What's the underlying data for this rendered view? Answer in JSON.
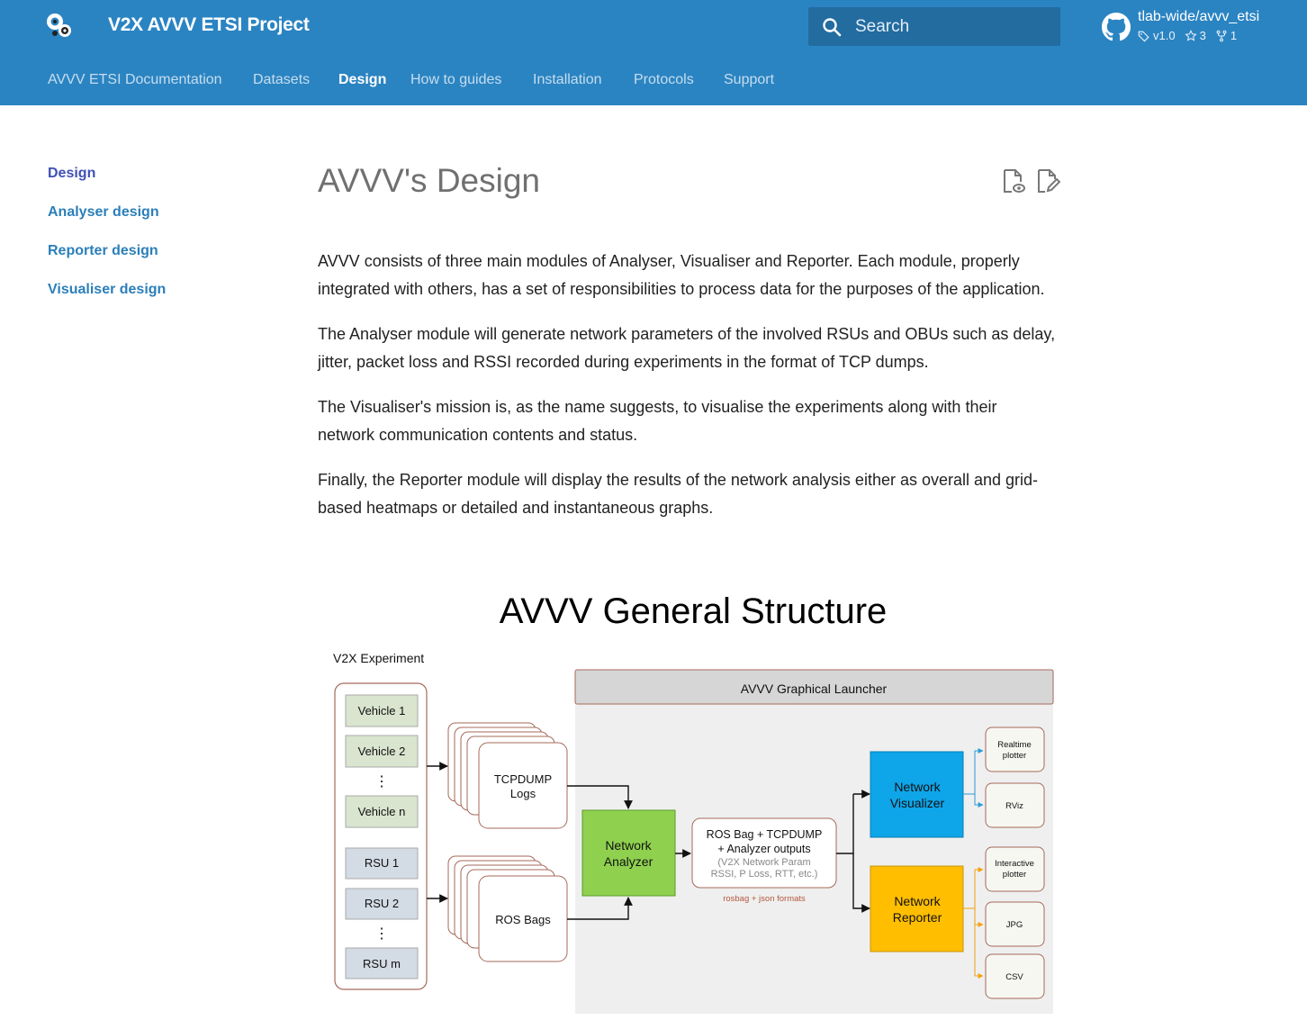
{
  "site": {
    "title": "V2X AVVV ETSI Project"
  },
  "search": {
    "placeholder": "Search"
  },
  "repo": {
    "name": "tlab-wide/avvv_etsi",
    "version": "v1.0",
    "stars": "3",
    "forks": "1"
  },
  "tabs": [
    {
      "label": "AVVV ETSI Documentation"
    },
    {
      "label": "Datasets"
    },
    {
      "label": "Design",
      "active": true
    },
    {
      "label": "How to guides"
    },
    {
      "label": "Installation"
    },
    {
      "label": "Protocols"
    },
    {
      "label": "Support"
    }
  ],
  "sidebar": {
    "items": [
      {
        "label": "Design",
        "active": true
      },
      {
        "label": "Analyser design"
      },
      {
        "label": "Reporter design"
      },
      {
        "label": "Visualiser design"
      }
    ]
  },
  "page": {
    "title": "AVVV's Design",
    "paragraphs": [
      "AVVV consists of three main modules of Analyser, Visualiser and Reporter. Each module, properly integrated with others, has a set of responsibilities to process data for the purposes of the application.",
      "The Analyser module will generate network parameters of the involved RSUs and OBUs such as delay, jitter, packet loss and RSSI recorded during experiments in the format of TCP dumps.",
      "The Visualiser's mission is, as the name suggests, to visualise the experiments along with their network communication contents and status.",
      "Finally, the Reporter module will display the results of the network analysis either as overall and grid-based heatmaps or detailed and instantaneous graphs."
    ]
  },
  "diagram": {
    "title": "AVVV General Structure",
    "experiment_label": "V2X Experiment",
    "launcher_label": "AVVV Graphical Launcher",
    "vehicles": [
      "Vehicle 1",
      "Vehicle 2",
      "Vehicle n"
    ],
    "rsus": [
      "RSU 1",
      "RSU 2",
      "RSU m"
    ],
    "ellipsis": "⋮",
    "tcpdump": [
      "TCPDUMP",
      "Logs"
    ],
    "rosbags": "ROS Bags",
    "analyzer": [
      "Network",
      "Analyzer"
    ],
    "outputs": [
      "ROS Bag + TCPDUMP",
      "+ Analyzer outputs",
      "(V2X Network Param",
      "RSSI, P Loss, RTT, etc.)"
    ],
    "formats": "rosbag + json formats",
    "visualizer": [
      "Network",
      "Visualizer"
    ],
    "reporter": [
      "Network",
      "Reporter"
    ],
    "vis_outputs": [
      [
        "Realtime",
        "plotter"
      ],
      [
        "RViz"
      ]
    ],
    "rep_outputs": [
      [
        "Interactive",
        "plotter"
      ],
      [
        "JPG"
      ],
      [
        "CSV"
      ]
    ],
    "colors": {
      "vehicle_fill": "#d9e5cf",
      "rsu_fill": "#d3dbe5",
      "analyzer_fill": "#8fd14f",
      "visualizer_fill": "#0ea5e9",
      "reporter_fill": "#ffbe00",
      "launcher_bg": "#efefef",
      "box_border": "#a66a5a"
    }
  }
}
